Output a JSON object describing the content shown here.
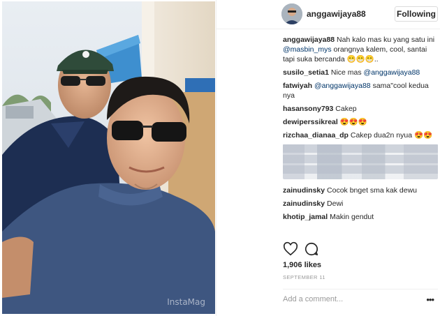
{
  "post": {
    "username": "anggawijaya88",
    "follow_label": "Following",
    "watermark": "InstaMag"
  },
  "caption": {
    "user": "anggawijaya88",
    "text_before": " Nah kalo mas ku yang satu ini ",
    "mention": "@masbin_mys",
    "text_after": " orangnya kalem, cool, santai tapi suka bercanda 😁😁😁.."
  },
  "comments": [
    {
      "user": "susilo_setia1",
      "pre": " Nice mas ",
      "mention": "@anggawijaya88",
      "post": ""
    },
    {
      "user": "fatwiyah",
      "pre": " ",
      "mention": "@anggawijaya88",
      "post": " sama\"cool kedua nya"
    },
    {
      "user": "hasansony793",
      "pre": " Cakep",
      "mention": "",
      "post": ""
    },
    {
      "user": "dewiperssikreal",
      "pre": " 😍😍😍",
      "mention": "",
      "post": ""
    },
    {
      "user": "rizchaa_dianaa_dp",
      "pre": " Cakep dua2n nyua 😍😍",
      "mention": "",
      "post": ""
    }
  ],
  "comments_after": [
    {
      "user": "zainudinsky",
      "text": " Cocok bnget sma kak dewu"
    },
    {
      "user": "zainudinsky",
      "text": " Dewi"
    },
    {
      "user": "khotip_jamal",
      "text": " Makin gendut"
    }
  ],
  "likes": "1,906 likes",
  "date": "SEPTEMBER 11",
  "add_comment_placeholder": "Add a comment...",
  "icons": [
    "heart-icon",
    "comment-icon",
    "more-options-icon"
  ],
  "colors": {
    "mention": "#003569",
    "text": "#262626",
    "muted": "#999999",
    "border": "#efefef"
  }
}
